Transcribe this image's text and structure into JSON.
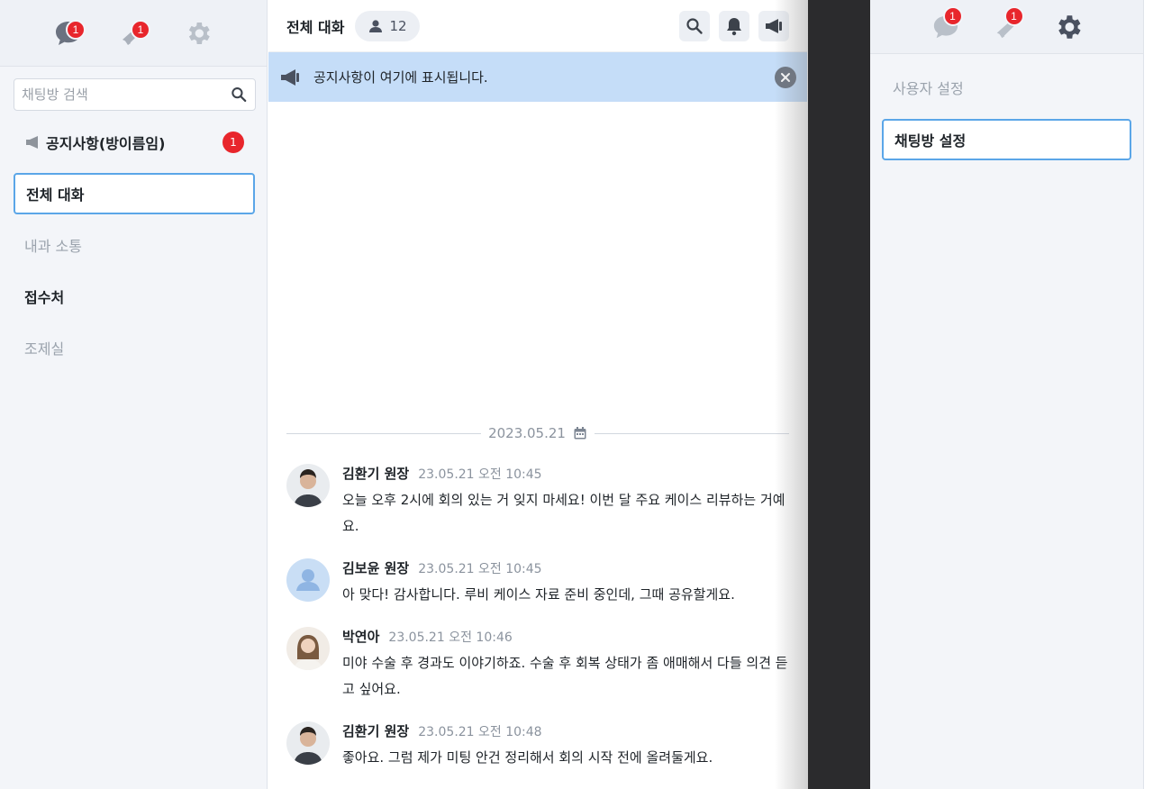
{
  "sidebar": {
    "search_placeholder": "채팅방 검색",
    "chat_badge": "1",
    "notice_badge": "1",
    "rooms": [
      {
        "label": "공지사항(방이름임)",
        "badge": "1"
      },
      {
        "label": "전체 대화"
      },
      {
        "label": "내과 소통"
      },
      {
        "label": "접수처"
      },
      {
        "label": "조제실"
      }
    ]
  },
  "header": {
    "title": "전체 대화",
    "member_count": "12"
  },
  "notice_bar": {
    "text": "공지사항이 여기에 표시됩니다."
  },
  "date_divider": "2023.05.21",
  "messages": [
    {
      "name": "김환기 원장",
      "time": "23.05.21 오전 10:45",
      "text": "오늘 오후 2시에 회의 있는 거 잊지 마세요! 이번 달 주요 케이스 리뷰하는 거예요."
    },
    {
      "name": "김보윤 원장",
      "time": "23.05.21 오전 10:45",
      "text": "아 맞다! 감사합니다. 루비 케이스 자료 준비 중인데, 그때 공유할게요."
    },
    {
      "name": "박연아",
      "time": "23.05.21 오전 10:46",
      "text": "미야 수술 후 경과도 이야기하죠. 수술 후 회복 상태가 좀 애매해서 다들 의견 듣고 싶어요."
    },
    {
      "name": "김환기 원장",
      "time": "23.05.21 오전 10:48",
      "text": "좋아요. 그럼 제가 미팅 안건 정리해서 회의 시작 전에 올려둘게요."
    }
  ],
  "settings_panel": {
    "chat_badge": "1",
    "notice_badge": "1",
    "items": [
      {
        "label": "사용자 설정"
      },
      {
        "label": "채팅방 설정"
      }
    ]
  },
  "colors": {
    "accent": "#5ba6e8",
    "badge": "#e8262c",
    "notice_bg": "#c5ddf8"
  }
}
